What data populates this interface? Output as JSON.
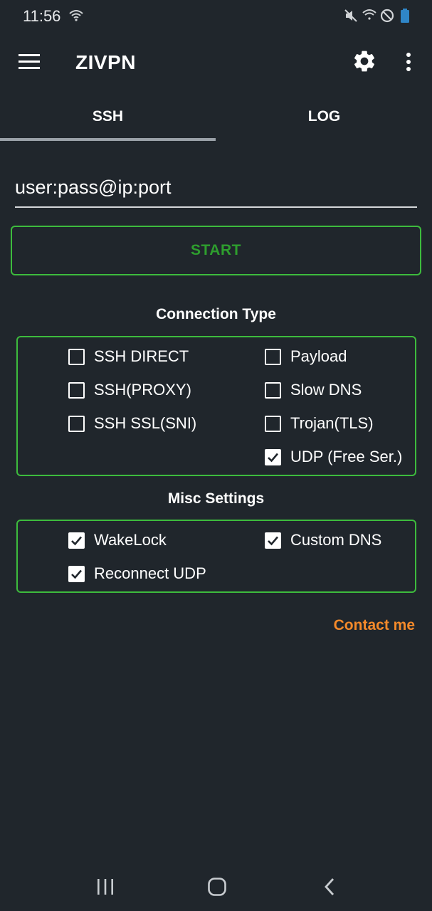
{
  "status_bar": {
    "time": "11:56",
    "icons": [
      "wifi-icon",
      "mute-icon",
      "wifi-signal-icon",
      "do-not-disturb-icon",
      "battery-icon"
    ]
  },
  "app_bar": {
    "title": "ZIVPN",
    "icons": [
      "menu-icon",
      "settings-gear-icon",
      "more-vertical-icon"
    ]
  },
  "tabs": [
    {
      "label": "SSH",
      "selected": true
    },
    {
      "label": "LOG",
      "selected": false
    }
  ],
  "server_input": {
    "value": "",
    "placeholder": "user:pass@ip:port"
  },
  "start_button": {
    "label": "START"
  },
  "connection_type": {
    "title": "Connection Type",
    "options": [
      {
        "label": "SSH DIRECT",
        "checked": false
      },
      {
        "label": "Payload",
        "checked": false
      },
      {
        "label": "SSH(PROXY)",
        "checked": false
      },
      {
        "label": "Slow DNS",
        "checked": false
      },
      {
        "label": "SSH SSL(SNI)",
        "checked": false
      },
      {
        "label": "Trojan(TLS)",
        "checked": false
      },
      {
        "label": "UDP (Free Ser.)",
        "checked": true
      }
    ]
  },
  "misc_settings": {
    "title": "Misc Settings",
    "options": [
      {
        "label": "WakeLock",
        "checked": true
      },
      {
        "label": "Custom DNS",
        "checked": true
      },
      {
        "label": "Reconnect UDP",
        "checked": true
      }
    ]
  },
  "contact_link": {
    "label": "Contact me"
  },
  "nav_bar": {
    "icons": [
      "recents-icon",
      "home-icon",
      "back-icon"
    ]
  },
  "colors": {
    "background": "#20262c",
    "accent_green": "#3dbb3d",
    "start_text": "#2e9e2e",
    "contact_orange": "#f58a2a"
  }
}
